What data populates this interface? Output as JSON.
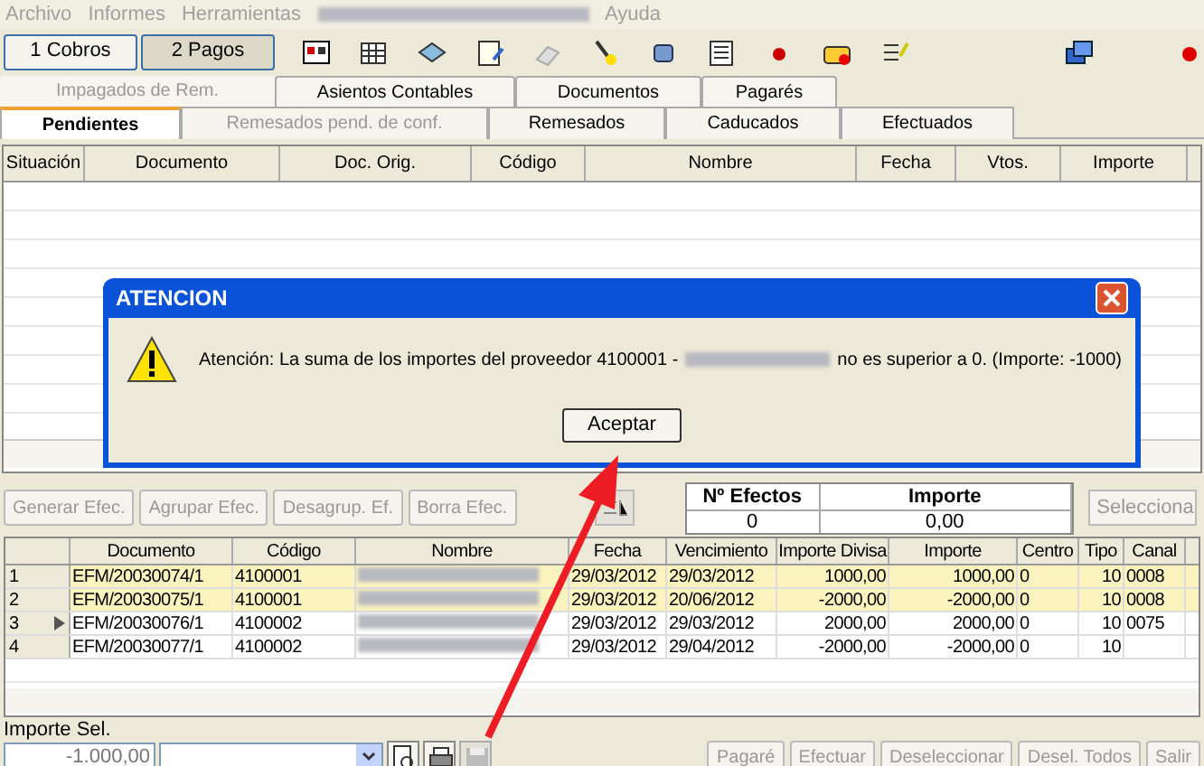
{
  "menu": [
    {
      "label": "Archivo",
      "kind": "text"
    },
    {
      "label": "Informes",
      "kind": "text"
    },
    {
      "label": "Herramientas",
      "kind": "text"
    },
    {
      "kind": "redacted"
    },
    {
      "label": "Ayuda",
      "kind": "text"
    }
  ],
  "mode_buttons": [
    {
      "label": "1 Cobros",
      "selected": false
    },
    {
      "label": "2 Pagos",
      "selected": true
    }
  ],
  "tabs_top": [
    {
      "label": "Impagados de Rem.",
      "disabled": true
    },
    {
      "label": "Asientos Contables",
      "disabled": false
    },
    {
      "label": "Documentos",
      "disabled": false
    },
    {
      "label": "Pagarés",
      "disabled": false
    }
  ],
  "tabs": [
    {
      "label": "Pendientes",
      "selected": true,
      "disabled": false
    },
    {
      "label": "Remesados pend. de conf.",
      "selected": false,
      "disabled": true
    },
    {
      "label": "Remesados",
      "selected": false,
      "disabled": false
    },
    {
      "label": "Caducados",
      "selected": false,
      "disabled": false
    },
    {
      "label": "Efectuados",
      "selected": false,
      "disabled": false
    }
  ],
  "top_grid": {
    "columns": [
      "Situación",
      "Documento",
      "Doc. Orig.",
      "Código",
      "Nombre",
      "Fecha",
      "Vtos.",
      "Importe"
    ]
  },
  "dialog": {
    "title": "ATENCION",
    "message_before": "Atención: La suma de los importes del proveedor 4100001 -",
    "message_after": "no es superior a 0. (Importe: -1000)",
    "button": "Aceptar"
  },
  "actions": [
    "Generar Efec.",
    "Agrupar Efec.",
    "Desagrup. Ef.",
    "Borra Efec."
  ],
  "summary": {
    "columns": [
      "Nº Efectos",
      "Importe"
    ],
    "values": [
      "0",
      "0,00"
    ]
  },
  "select_button": "Selecciona",
  "bottom_grid": {
    "columns": [
      "Documento",
      "Código",
      "Nombre",
      "Fecha",
      "Vencimiento",
      "Importe Divisa",
      "Importe",
      "Centro",
      "Tipo",
      "Canal"
    ],
    "rows": [
      {
        "num": "1",
        "current": false,
        "highlighted": true,
        "cells": [
          "EFM/20030074/1",
          "4100001",
          null,
          "29/03/2012",
          "29/03/2012",
          "1000,00",
          "1000,00",
          "0",
          "10",
          "0008"
        ]
      },
      {
        "num": "2",
        "current": false,
        "highlighted": true,
        "cells": [
          "EFM/20030075/1",
          "4100001",
          null,
          "29/03/2012",
          "20/06/2012",
          "-2000,00",
          "-2000,00",
          "0",
          "10",
          "0008"
        ]
      },
      {
        "num": "3",
        "current": true,
        "highlighted": false,
        "cells": [
          "EFM/20030076/1",
          "4100002",
          null,
          "29/03/2012",
          "29/03/2012",
          "2000,00",
          "2000,00",
          "0",
          "10",
          "0075"
        ]
      },
      {
        "num": "4",
        "current": false,
        "highlighted": false,
        "cells": [
          "EFM/20030077/1",
          "4100002",
          null,
          "29/03/2012",
          "29/04/2012",
          "-2000,00",
          "-2000,00",
          "0",
          "10",
          ""
        ]
      }
    ]
  },
  "importe_sel": {
    "label": "Importe Sel.",
    "value": "-1.000,00"
  },
  "footer_buttons": [
    "Pagaré",
    "Efectuar",
    "Deseleccionar",
    "Desel. Todos",
    "Salir"
  ]
}
